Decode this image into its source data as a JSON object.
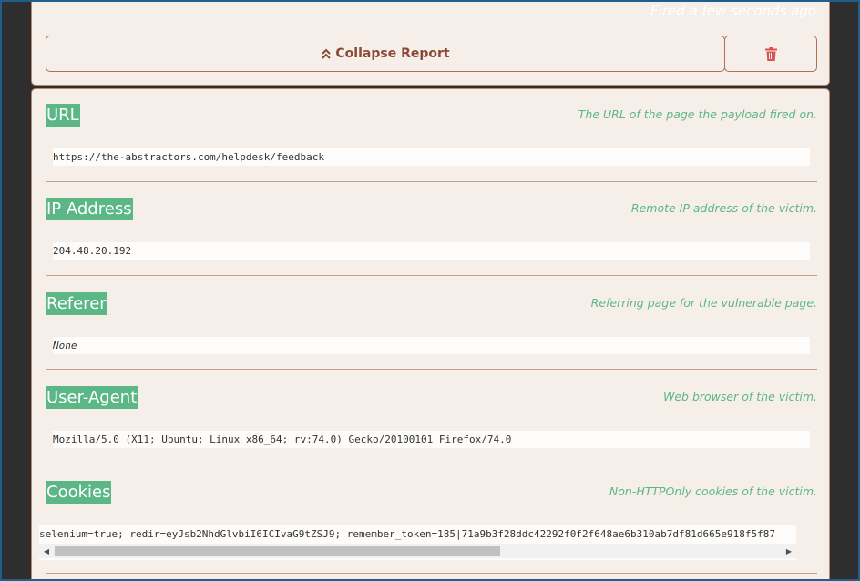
{
  "header": {
    "fired_text": "Fired a few seconds ago",
    "collapse_label": "Collapse Report",
    "collapse_icon": "double-chevron-up-icon",
    "delete_icon": "trash-icon"
  },
  "fields": [
    {
      "title": "URL",
      "description": "The URL of the page the payload fired on.",
      "value": "https://the-abstractors.com/helpdesk/feedback"
    },
    {
      "title": "IP Address",
      "description": "Remote IP address of the victim.",
      "value": "204.48.20.192"
    },
    {
      "title": "Referer",
      "description": "Referring page for the vulnerable page.",
      "value": "None"
    },
    {
      "title": "User-Agent",
      "description": "Web browser of the victim.",
      "value": "Mozilla/5.0 (X11; Ubuntu; Linux x86_64; rv:74.0) Gecko/20100101 Firefox/74.0"
    },
    {
      "title": "Cookies",
      "description": "Non-HTTPOnly cookies of the victim.",
      "value": "selenium=true; redir=eyJsb2NhdGlvbiI6ICIvaG9tZSJ9; remember_token=185|71a9b3f28ddc42292f0f2f648ae6b310ab7df81d665e918f5f87"
    }
  ],
  "colors": {
    "accent_green": "#5bb786",
    "card_bg": "#f6efe9",
    "button_text": "#8a4a33",
    "delete_red": "#d9534f",
    "page_bg": "#2e2e2e"
  }
}
